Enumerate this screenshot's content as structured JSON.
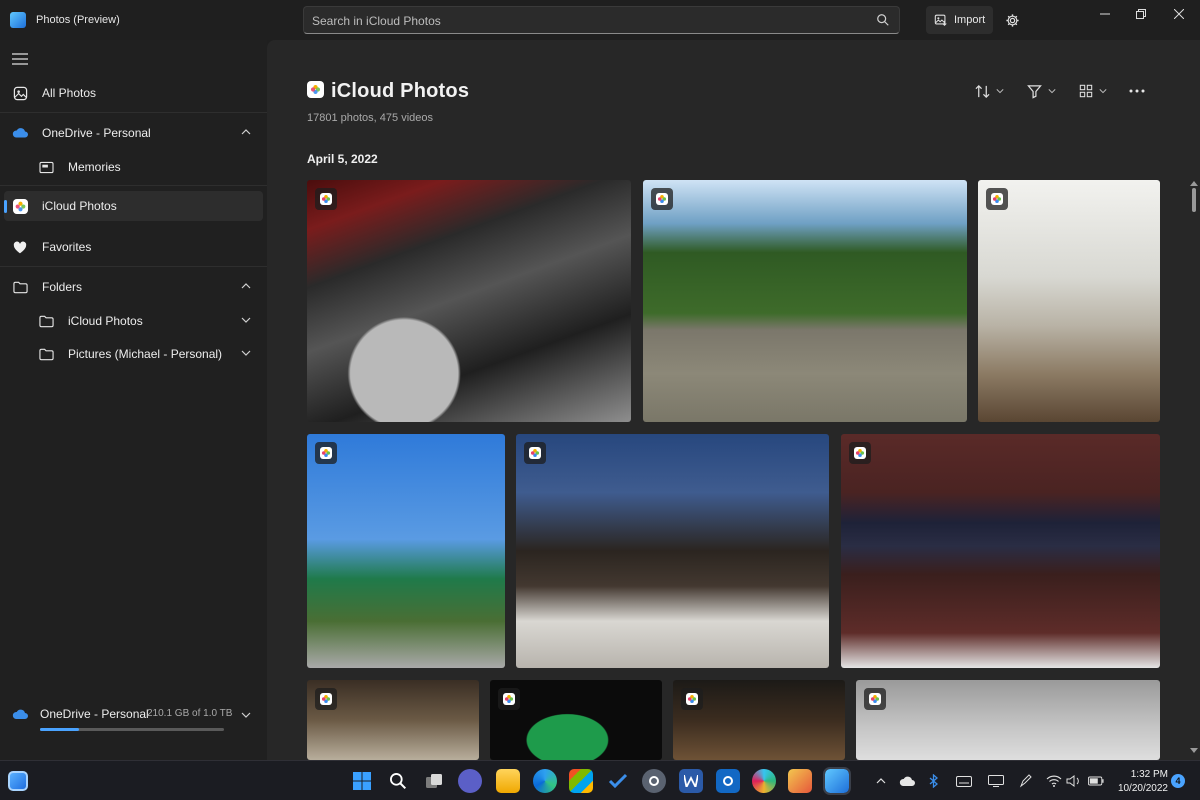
{
  "window": {
    "title": "Photos (Preview)"
  },
  "search": {
    "placeholder": "Search in iCloud Photos"
  },
  "toolbar": {
    "import_label": "Import"
  },
  "sidebar": {
    "items": [
      {
        "label": "All Photos"
      },
      {
        "label": "OneDrive - Personal"
      },
      {
        "label": "Memories"
      },
      {
        "label": "iCloud Photos"
      },
      {
        "label": "Favorites"
      },
      {
        "label": "Folders"
      },
      {
        "label": "iCloud Photos"
      },
      {
        "label": "Pictures (Michael - Personal)"
      }
    ],
    "storage": {
      "label": "OneDrive - Personal",
      "size": "210.1 GB of 1.0 TB",
      "used_fraction": 0.21
    }
  },
  "main": {
    "title": "iCloud Photos",
    "count": "17801 photos, 475 videos",
    "date_header": "April 5, 2022"
  },
  "taskbar": {
    "time": "1:32 PM",
    "date": "10/20/2022",
    "notifications": "4"
  },
  "colors": {
    "accent": "#4aa3ff",
    "sidebar": "#202020",
    "content": "#272727"
  }
}
